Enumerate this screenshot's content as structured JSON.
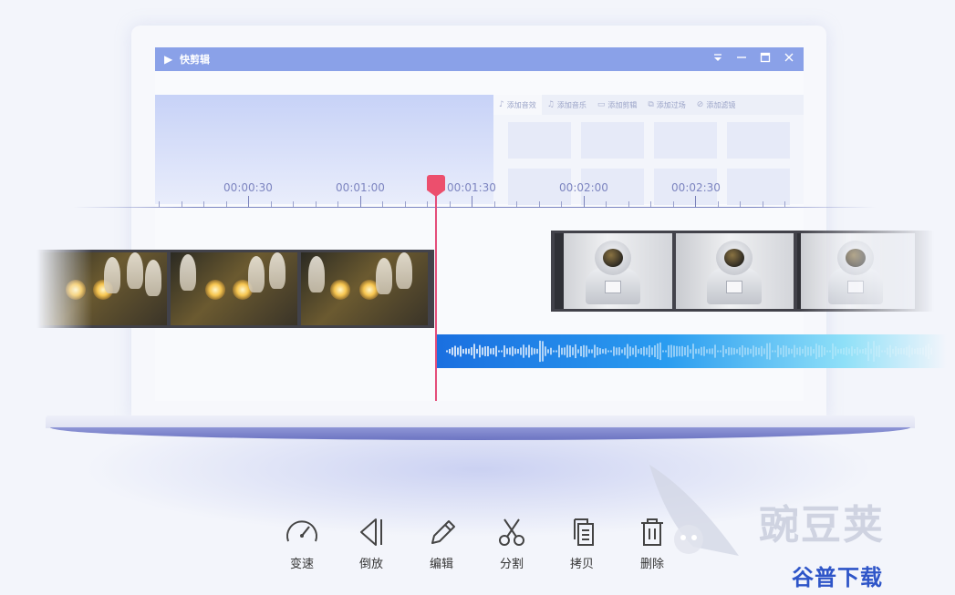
{
  "app": {
    "title": "快剪辑"
  },
  "window_controls": {
    "menu_icon": "menu-down-icon",
    "minimize_icon": "minimize-icon",
    "maximize_icon": "maximize-icon",
    "close_icon": "close-icon"
  },
  "tabs": [
    {
      "label": "添加音效",
      "icon": "sound-effect-icon"
    },
    {
      "label": "添加音乐",
      "icon": "music-icon"
    },
    {
      "label": "添加剪辑",
      "icon": "video-clip-icon"
    },
    {
      "label": "添加过场",
      "icon": "transition-icon"
    },
    {
      "label": "添加滤镜",
      "icon": "filter-icon"
    }
  ],
  "timeline": {
    "labels": [
      "00:00:30",
      "00:01:00",
      "00:01:30",
      "00:02:00",
      "00:02:30"
    ]
  },
  "toolbar": [
    {
      "label": "变速",
      "icon": "speedometer-icon"
    },
    {
      "label": "倒放",
      "icon": "reverse-play-icon"
    },
    {
      "label": "编辑",
      "icon": "pencil-icon"
    },
    {
      "label": "分割",
      "icon": "scissors-icon"
    },
    {
      "label": "拷贝",
      "icon": "copy-icon"
    },
    {
      "label": "删除",
      "icon": "trash-icon"
    }
  ],
  "watermark": {
    "brand": "豌豆荚",
    "sub": "谷普下载"
  },
  "colors": {
    "titlebar": "#8aa1e8",
    "playhead": "#ec4f6d",
    "audio_start": "#1a6fe0",
    "audio_end": "#8fe0f8",
    "timeline_text": "#7d85c0"
  }
}
